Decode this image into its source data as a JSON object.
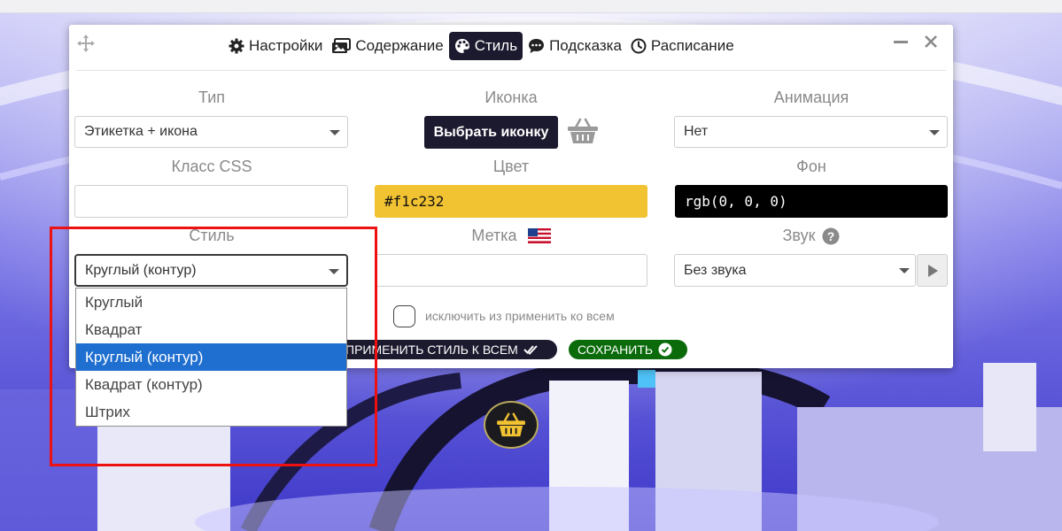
{
  "colors": {
    "tab_active_bg": "#1c1a2e",
    "color_field_bg": "#f1c232",
    "bg_field_bg": "#000000",
    "save_green": "#0b6b0b",
    "selected_option": "#1f6fd0",
    "highlight_red": "#ee1111",
    "hotspot_accent": "#f1c232"
  },
  "tabs": [
    {
      "label": "Настройки",
      "icon": "gear-icon"
    },
    {
      "label": "Содержание",
      "icon": "images-icon"
    },
    {
      "label": "Стиль",
      "icon": "palette-icon",
      "active": true
    },
    {
      "label": "Подсказка",
      "icon": "comment-dots-icon"
    },
    {
      "label": "Расписание",
      "icon": "clock-icon"
    }
  ],
  "window": {
    "minimize_icon": "minimize-icon",
    "close_icon": "close-icon",
    "move_icon": "move-icon"
  },
  "form": {
    "type": {
      "label": "Тип",
      "value": "Этикетка + икона"
    },
    "icon": {
      "label": "Иконка",
      "button": "Выбрать иконку",
      "preview_icon": "basket-icon"
    },
    "animation": {
      "label": "Анимация",
      "value": "Нет"
    },
    "css_class": {
      "label": "Класс CSS",
      "value": ""
    },
    "color": {
      "label": "Цвет",
      "value": "#f1c232"
    },
    "background": {
      "label": "Фон",
      "value": "rgb(0, 0, 0)"
    },
    "style": {
      "label": "Стиль",
      "value": "Круглый (контур)",
      "options": [
        "Круглый",
        "Квадрат",
        "Круглый (контур)",
        "Квадрат (контур)",
        "Штрих"
      ],
      "selected_index": 2
    },
    "label_field": {
      "label": "Метка",
      "flag_icon": "us-flag-icon",
      "value": ""
    },
    "sound": {
      "label": "Звук",
      "help_icon": "question-circle-icon",
      "value": "Без звука",
      "play_icon": "play-icon"
    },
    "exclude": {
      "label": "исключить из применить ко всем",
      "checked": false
    },
    "apply_all_button": "ПРИМЕНИТЬ СТИЛЬ К ВСЕМ",
    "save_button": "СОХРАНИТЬ"
  },
  "hotspot": {
    "icon": "basket-icon"
  }
}
